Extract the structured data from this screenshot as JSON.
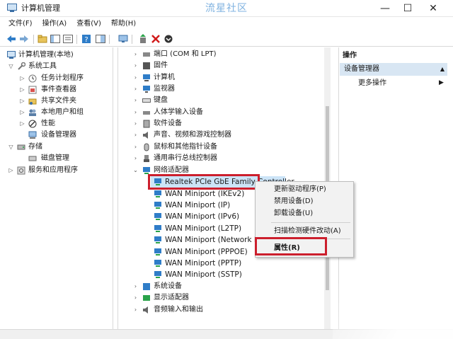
{
  "window": {
    "title": "计算机管理",
    "watermark": "流星社区",
    "minimize_glyph": "—",
    "maximize_glyph": "☐",
    "close_glyph": "✕"
  },
  "menu": [
    "文件(F)",
    "操作(A)",
    "查看(V)",
    "帮助(H)"
  ],
  "left_tree": [
    {
      "label": "计算机管理(本地)"
    },
    {
      "label": "系统工具"
    },
    {
      "label": "任务计划程序"
    },
    {
      "label": "事件查看器"
    },
    {
      "label": "共享文件夹"
    },
    {
      "label": "本地用户和组"
    },
    {
      "label": "性能"
    },
    {
      "label": "设备管理器"
    },
    {
      "label": "存储"
    },
    {
      "label": "磁盘管理"
    },
    {
      "label": "服务和应用程序"
    }
  ],
  "device_tree": [
    {
      "label": "端口 (COM 和 LPT)"
    },
    {
      "label": "固件"
    },
    {
      "label": "计算机"
    },
    {
      "label": "监视器"
    },
    {
      "label": "键盘"
    },
    {
      "label": "人体学输入设备"
    },
    {
      "label": "软件设备"
    },
    {
      "label": "声音、视频和游戏控制器"
    },
    {
      "label": "鼠标和其他指针设备"
    },
    {
      "label": "通用串行总线控制器"
    },
    {
      "label": "网络适配器"
    },
    {
      "label": "Realtek PCIe GbE Family Controller"
    },
    {
      "label": "WAN Miniport (IKEv2)"
    },
    {
      "label": "WAN Miniport (IP)"
    },
    {
      "label": "WAN Miniport (IPv6)"
    },
    {
      "label": "WAN Miniport (L2TP)"
    },
    {
      "label": "WAN Miniport (Network Monitor)"
    },
    {
      "label": "WAN Miniport (PPPOE)"
    },
    {
      "label": "WAN Miniport (PPTP)"
    },
    {
      "label": "WAN Miniport (SSTP)"
    },
    {
      "label": "系统设备"
    },
    {
      "label": "显示适配器"
    },
    {
      "label": "音频输入和输出"
    }
  ],
  "actions": {
    "title": "操作",
    "section": "设备管理器",
    "more": "更多操作"
  },
  "context_menu": {
    "update_driver": "更新驱动程序(P)",
    "disable_device": "禁用设备(D)",
    "uninstall_device": "卸载设备(U)",
    "scan_hardware": "扫描检测硬件改动(A)",
    "properties": "属性(R)"
  },
  "colors": {
    "highlight_red": "#cc1f2d",
    "selection_blue": "#cce4f7",
    "section_blue": "#d8e6f3",
    "watermark": "#7fb2e0"
  }
}
